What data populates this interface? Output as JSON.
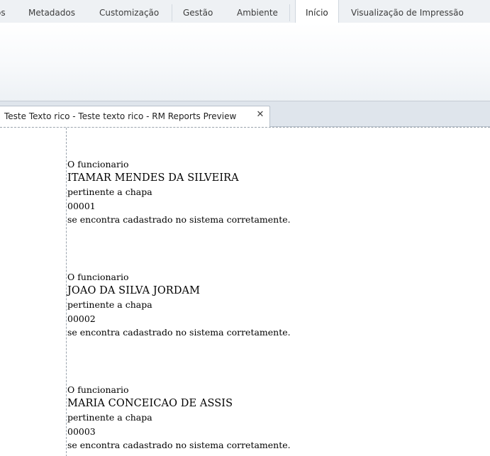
{
  "ribbon": {
    "tabs": [
      {
        "label": "os"
      },
      {
        "label": "Metadados"
      },
      {
        "label": "Customização"
      },
      {
        "label": "Gestão"
      },
      {
        "label": "Ambiente"
      },
      {
        "label": "Início"
      },
      {
        "label": "Visualização de Impressão"
      }
    ],
    "active_tab": "Início"
  },
  "document": {
    "tab_title": "Teste Texto rico - Teste texto rico - RM Reports Preview",
    "close_glyph": "✕"
  },
  "report": {
    "records": [
      {
        "intro": "O funcionario",
        "name": "ITAMAR MENDES  DA SILVEIRA",
        "chapa_label": "pertinente a chapa",
        "chapa": "00001",
        "outro": "se encontra cadastrado no sistema corretamente."
      },
      {
        "intro": "O funcionario",
        "name": "JOAO DA SILVA  JORDAM",
        "chapa_label": "pertinente a chapa",
        "chapa": "00002",
        "outro": "se encontra cadastrado no sistema corretamente."
      },
      {
        "intro": "O funcionario",
        "name": "MARIA CONCEICAO  DE ASSIS",
        "chapa_label": "pertinente a chapa",
        "chapa": "00003",
        "outro": "se encontra cadastrado no sistema corretamente."
      }
    ]
  }
}
